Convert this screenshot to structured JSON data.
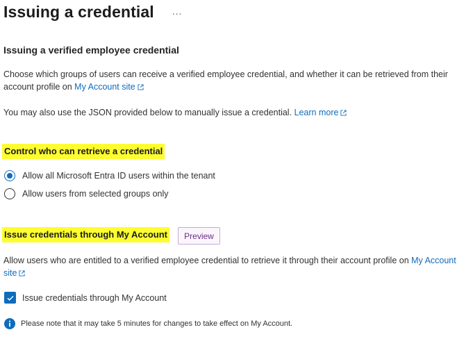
{
  "page": {
    "title": "Issuing a credential",
    "more_icon": "..."
  },
  "issuing_section": {
    "heading": "Issuing a verified employee credential",
    "description_part1": "Choose which groups of users can receive a verified employee credential, and whether it can be retrieved from their account profile on ",
    "my_account_link": "My Account site",
    "json_text": "You may also use the JSON provided below to manually issue a credential. ",
    "learn_more_link": "Learn more"
  },
  "control_section": {
    "heading": "Control who can retrieve a credential",
    "options": [
      {
        "label": "Allow all Microsoft Entra ID users within the tenant",
        "selected": true
      },
      {
        "label": "Allow users from selected groups only",
        "selected": false
      }
    ]
  },
  "my_account_section": {
    "heading": "Issue credentials through My Account",
    "badge": "Preview",
    "description": "Allow users who are entitled to a verified employee credential to retrieve it through their account profile on ",
    "my_account_link": "My Account site",
    "checkbox_label": "Issue credentials through My Account",
    "checkbox_checked": true,
    "info_text": "Please note that it may take 5 minutes for changes to take effect on My Account."
  },
  "colors": {
    "accent": "#0f6cbd",
    "highlight": "#fdfd30",
    "preview_badge": "#6b2d8c"
  },
  "icons": [
    "more-icon",
    "external-link-icon",
    "checkmark-icon",
    "info-icon"
  ]
}
